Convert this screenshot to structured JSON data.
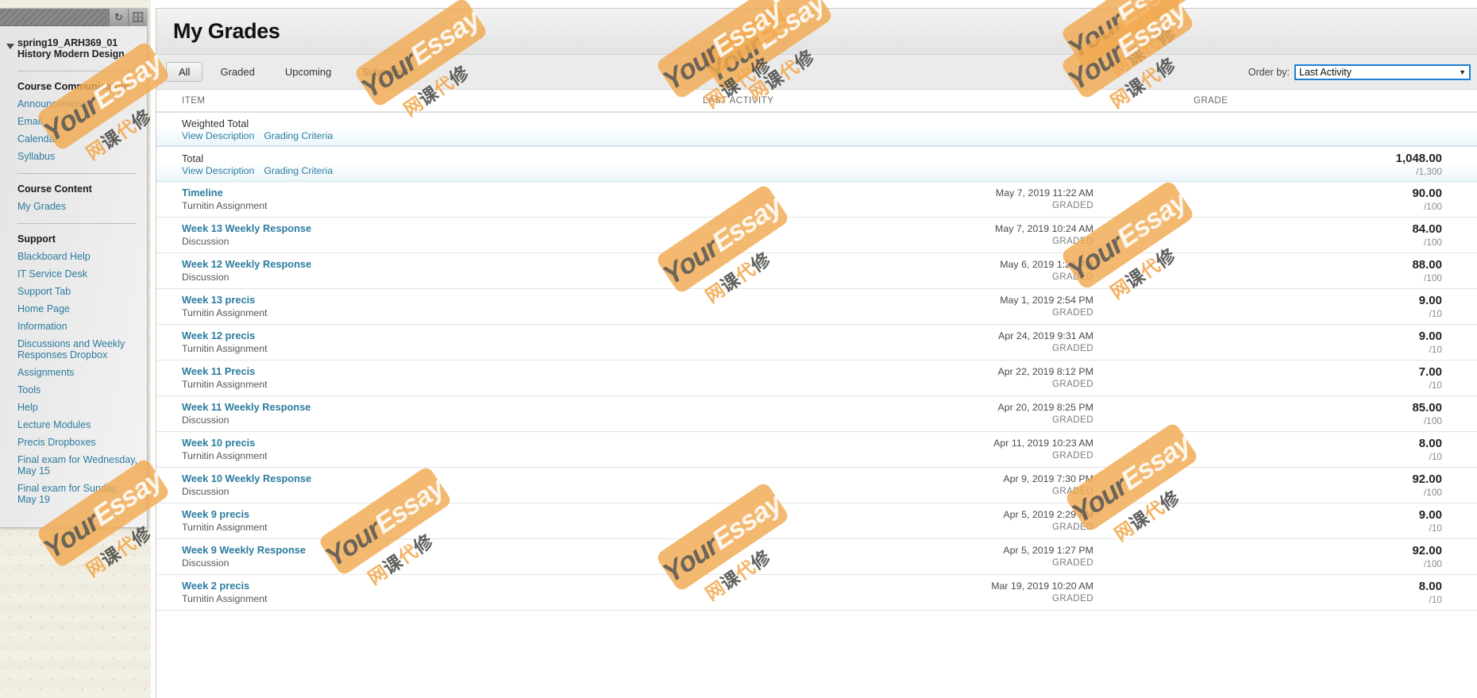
{
  "sidebar": {
    "toolbar_icons": [
      "refresh-icon",
      "detach-icon"
    ],
    "course_title": "spring19_ARH369_01 History Modern Design",
    "groups": [
      {
        "heading": "Course Communication",
        "items": [
          "Announcements",
          "Email",
          "Calendar",
          "Syllabus"
        ]
      },
      {
        "heading": "Course Content",
        "items": [
          "My Grades"
        ]
      },
      {
        "heading": "Support",
        "items": [
          "Blackboard Help",
          "IT Service Desk",
          "Support Tab",
          "Home Page",
          "Information",
          "Discussions and Weekly Responses Dropbox",
          "Assignments",
          "Tools",
          "Help",
          "Lecture Modules",
          "Precis Dropboxes",
          "Final exam for Wednesday, May 15",
          "Final exam for Sunday, May 19"
        ]
      }
    ]
  },
  "header": {
    "title": "My Grades"
  },
  "filters": {
    "tabs": [
      {
        "label": "All",
        "active": true
      },
      {
        "label": "Graded",
        "active": false
      },
      {
        "label": "Upcoming",
        "active": false
      },
      {
        "label": "Submitted",
        "active": false
      }
    ],
    "order_by_label": "Order by:",
    "order_by_value": "Last Activity"
  },
  "table": {
    "columns": {
      "item": "ITEM",
      "last_activity": "LAST ACTIVITY",
      "grade": "GRADE"
    },
    "view_description_label": "View Description",
    "grading_criteria_label": "Grading Criteria",
    "totals": [
      {
        "name": "Weighted Total",
        "links": [
          "View Description",
          "Grading Criteria"
        ],
        "activity": "",
        "status": "",
        "score": "",
        "out_of": ""
      },
      {
        "name": "Total",
        "links": [
          "View Description",
          "Grading Criteria"
        ],
        "activity": "",
        "status": "",
        "score": "1,048.00",
        "out_of": "/1,300"
      }
    ],
    "rows": [
      {
        "name": "Timeline",
        "type": "Turnitin Assignment",
        "activity": "May 7, 2019 11:22 AM",
        "status": "GRADED",
        "score": "90.00",
        "out_of": "/100"
      },
      {
        "name": "Week 13 Weekly Response",
        "type": "Discussion",
        "activity": "May 7, 2019 10:24 AM",
        "status": "GRADED",
        "score": "84.00",
        "out_of": "/100"
      },
      {
        "name": "Week 12 Weekly Response",
        "type": "Discussion",
        "activity": "May 6, 2019 1:24 PM",
        "status": "GRADED",
        "score": "88.00",
        "out_of": "/100"
      },
      {
        "name": "Week 13 precis",
        "type": "Turnitin Assignment",
        "activity": "May 1, 2019 2:54 PM",
        "status": "GRADED",
        "score": "9.00",
        "out_of": "/10"
      },
      {
        "name": "Week 12 precis",
        "type": "Turnitin Assignment",
        "activity": "Apr 24, 2019 9:31 AM",
        "status": "GRADED",
        "score": "9.00",
        "out_of": "/10"
      },
      {
        "name": "Week 11 Precis",
        "type": "Turnitin Assignment",
        "activity": "Apr 22, 2019 8:12 PM",
        "status": "GRADED",
        "score": "7.00",
        "out_of": "/10"
      },
      {
        "name": "Week 11 Weekly Response",
        "type": "Discussion",
        "activity": "Apr 20, 2019 8:25 PM",
        "status": "GRADED",
        "score": "85.00",
        "out_of": "/100"
      },
      {
        "name": "Week 10 precis",
        "type": "Turnitin Assignment",
        "activity": "Apr 11, 2019 10:23 AM",
        "status": "GRADED",
        "score": "8.00",
        "out_of": "/10"
      },
      {
        "name": "Week 10 Weekly Response",
        "type": "Discussion",
        "activity": "Apr 9, 2019 7:30 PM",
        "status": "GRADED",
        "score": "92.00",
        "out_of": "/100"
      },
      {
        "name": "Week 9 precis",
        "type": "Turnitin Assignment",
        "activity": "Apr 5, 2019 2:29 PM",
        "status": "GRADED",
        "score": "9.00",
        "out_of": "/10"
      },
      {
        "name": "Week 9 Weekly Response",
        "type": "Discussion",
        "activity": "Apr 5, 2019 1:27 PM",
        "status": "GRADED",
        "score": "92.00",
        "out_of": "/100"
      },
      {
        "name": "Week 2 precis",
        "type": "Turnitin Assignment",
        "activity": "Mar 19, 2019 10:20 AM",
        "status": "GRADED",
        "score": "8.00",
        "out_of": "/10"
      }
    ]
  },
  "watermark": {
    "english": "YourEssay",
    "chinese": "网课代修"
  },
  "colors": {
    "link": "#2b7c9e",
    "watermark_orange": "#f2a950",
    "select_border": "#1b7fd4"
  }
}
